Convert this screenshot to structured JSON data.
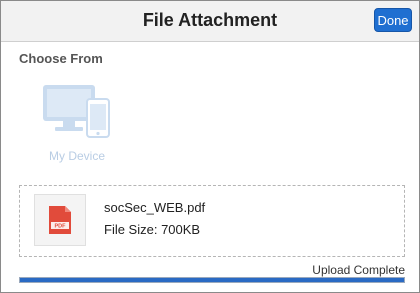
{
  "dialog": {
    "title": "File Attachment",
    "done_label": "Done"
  },
  "chooser": {
    "heading": "Choose From",
    "device_label": "My Device",
    "device_icon": "desktop-mobile-icon"
  },
  "file": {
    "name": "socSec_WEB.pdf",
    "size_text": "File Size: 700KB",
    "icon": "pdf-file-icon",
    "icon_text": "PDF"
  },
  "upload": {
    "status": "Upload Complete",
    "progress": 1.0
  },
  "colors": {
    "accent": "#1f6fd1",
    "progress": "#2a6ac4",
    "pdf_red": "#e14b3b",
    "device_icon": "#c9dbef"
  }
}
